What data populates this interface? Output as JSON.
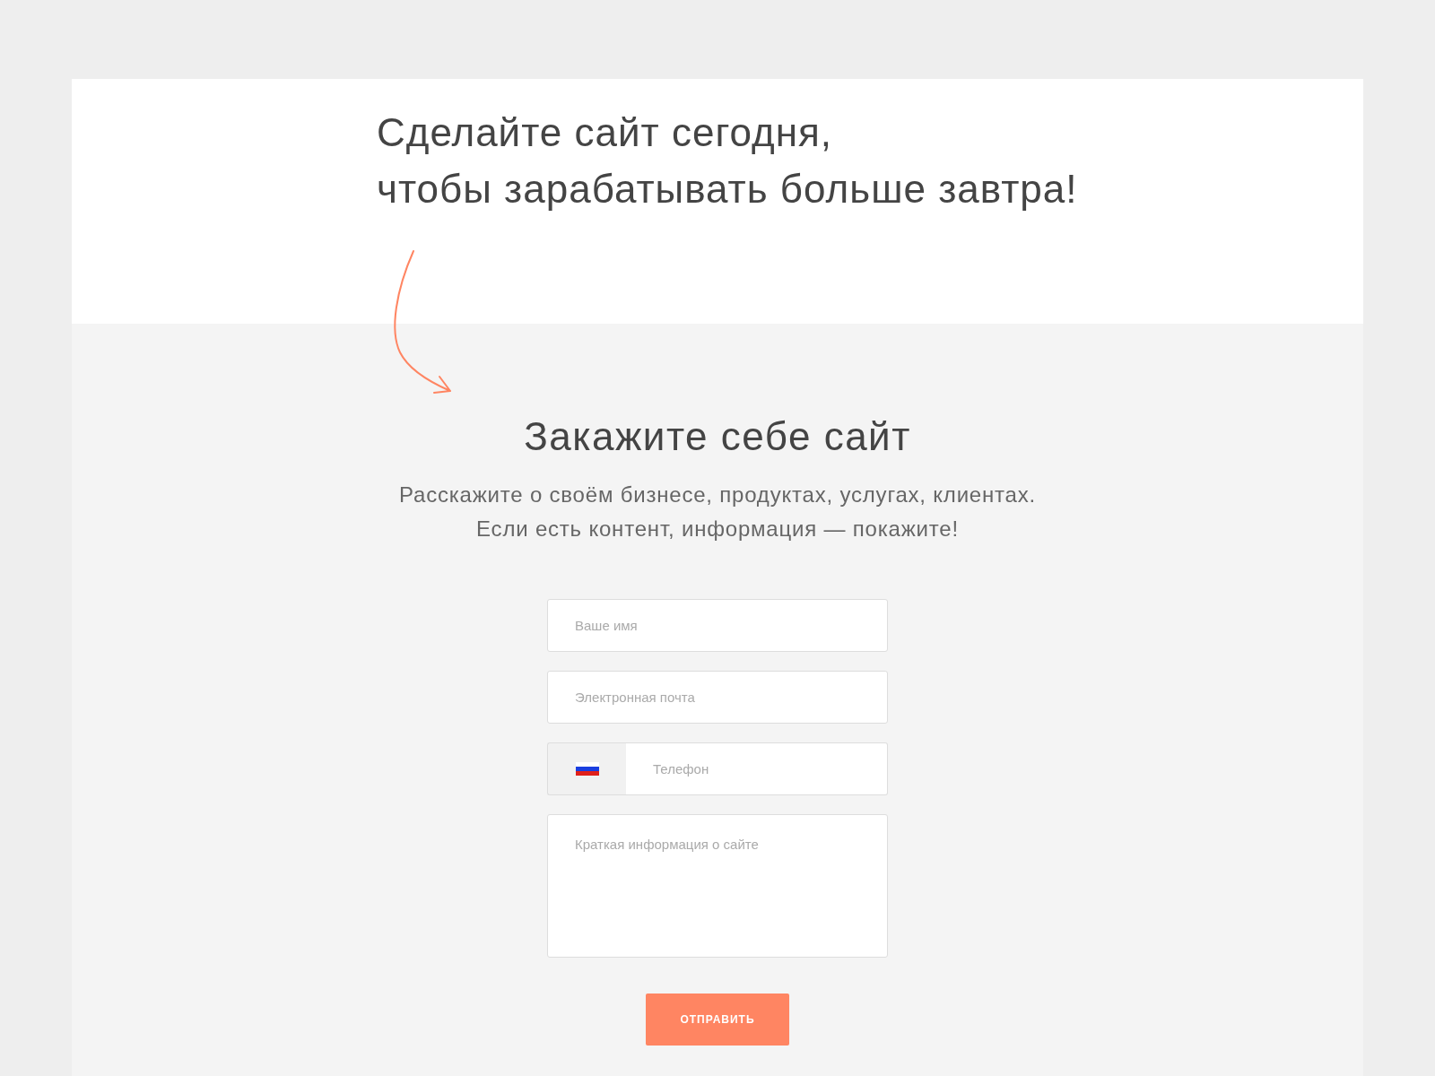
{
  "hero": {
    "headline_lines": [
      "Сделайте сайт сегодня,",
      "чтобы зарабатывать больше завтра!"
    ]
  },
  "order_form": {
    "title": "Закажите себе сайт",
    "subtitle_lines": [
      "Расскажите о своём бизнесе, продуктах, услугах, клиентах.",
      "Если есть контент, информация — покажите!"
    ],
    "fields": [
      {
        "kind": "text",
        "placeholder": "Ваше имя"
      },
      {
        "kind": "email",
        "placeholder": "Электронная почта"
      },
      {
        "kind": "phone",
        "placeholder": "Телефон"
      },
      {
        "kind": "textarea",
        "placeholder": "Краткая информация о сайте"
      }
    ],
    "submit": "ОТПРАВИТЬ"
  }
}
